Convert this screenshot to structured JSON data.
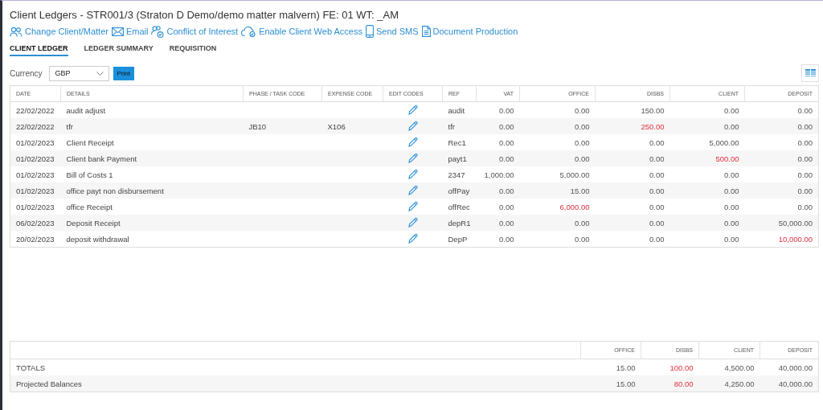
{
  "window": {
    "title": "Client Ledgers - STR001/3 (Straton D Demo/demo matter malvern) FE: 01 WT: _AM"
  },
  "actions": [
    {
      "kind": "people",
      "label": "Change Client/Matter"
    },
    {
      "kind": "mail",
      "label": "Email"
    },
    {
      "kind": "conflict",
      "label": "Conflict of Interest"
    },
    {
      "kind": "cloud",
      "label": "Enable Client Web Access"
    },
    {
      "kind": "phone",
      "label": "Send SMS"
    },
    {
      "kind": "document",
      "label": "Document Production"
    }
  ],
  "tabs": [
    {
      "label": "CLIENT LEDGER",
      "selected": true
    },
    {
      "label": "LEDGER SUMMARY",
      "selected": false
    },
    {
      "label": "REQUISITION",
      "selected": false
    }
  ],
  "currency": {
    "label": "Currency",
    "value": "GBP"
  },
  "print_button": "Print",
  "table": {
    "columns": [
      "DATE",
      "DETAILS",
      "PHASE / TASK CODE",
      "EXPENSE CODE",
      "EDIT CODES",
      "REF",
      "VAT",
      "OFFICE",
      "DISBS",
      "CLIENT",
      "DEPOSIT"
    ],
    "rows": [
      {
        "date": "22/02/2022",
        "details": "audit adjust",
        "ref": "audit",
        "amounts": [
          {
            "value": "0.00",
            "negative": false
          },
          {
            "value": "0.00",
            "negative": false
          },
          {
            "value": "150.00",
            "negative": false
          },
          {
            "value": "0.00",
            "negative": false
          },
          {
            "value": "0.00",
            "negative": false
          }
        ]
      },
      {
        "date": "22/02/2022",
        "details": "tfr",
        "phase": "JB10",
        "expense": "X106",
        "ref": "tfr",
        "amounts": [
          {
            "value": "0.00",
            "negative": false
          },
          {
            "value": "0.00",
            "negative": false
          },
          {
            "value": "250.00",
            "negative": true
          },
          {
            "value": "0.00",
            "negative": false
          },
          {
            "value": "0.00",
            "negative": false
          }
        ]
      },
      {
        "date": "01/02/2023",
        "details": "Client Receipt",
        "ref": "Rec1",
        "amounts": [
          {
            "value": "0.00",
            "negative": false
          },
          {
            "value": "0.00",
            "negative": false
          },
          {
            "value": "0.00",
            "negative": false
          },
          {
            "value": "5,000.00",
            "negative": false
          },
          {
            "value": "0.00",
            "negative": false
          }
        ]
      },
      {
        "date": "01/02/2023",
        "details": "Client bank Payment",
        "ref": "payt1",
        "amounts": [
          {
            "value": "0.00",
            "negative": false
          },
          {
            "value": "0.00",
            "negative": false
          },
          {
            "value": "0.00",
            "negative": false
          },
          {
            "value": "500.00",
            "negative": true
          },
          {
            "value": "0.00",
            "negative": false
          }
        ]
      },
      {
        "date": "01/02/2023",
        "details": "Bill of Costs 1",
        "ref": "2347",
        "amounts": [
          {
            "value": "1,000.00",
            "negative": false
          },
          {
            "value": "5,000.00",
            "negative": false
          },
          {
            "value": "0.00",
            "negative": false
          },
          {
            "value": "0.00",
            "negative": false
          },
          {
            "value": "0.00",
            "negative": false
          }
        ]
      },
      {
        "date": "01/02/2023",
        "details": "office payt non disbursement",
        "ref": "offPay",
        "amounts": [
          {
            "value": "0.00",
            "negative": false
          },
          {
            "value": "15.00",
            "negative": false
          },
          {
            "value": "0.00",
            "negative": false
          },
          {
            "value": "0.00",
            "negative": false
          },
          {
            "value": "0.00",
            "negative": false
          }
        ]
      },
      {
        "date": "01/02/2023",
        "details": "office Receipt",
        "ref": "offRec",
        "amounts": [
          {
            "value": "0.00",
            "negative": false
          },
          {
            "value": "6,000.00",
            "negative": true
          },
          {
            "value": "0.00",
            "negative": false
          },
          {
            "value": "0.00",
            "negative": false
          },
          {
            "value": "0.00",
            "negative": false
          }
        ]
      },
      {
        "date": "06/02/2023",
        "details": "Deposit Receipt",
        "ref": "depR1",
        "amounts": [
          {
            "value": "0.00",
            "negative": false
          },
          {
            "value": "0.00",
            "negative": false
          },
          {
            "value": "0.00",
            "negative": false
          },
          {
            "value": "0.00",
            "negative": false
          },
          {
            "value": "50,000.00",
            "negative": false
          }
        ]
      },
      {
        "date": "20/02/2023",
        "details": "deposit withdrawal",
        "ref": "DepP",
        "amounts": [
          {
            "value": "0.00",
            "negative": false
          },
          {
            "value": "0.00",
            "negative": false
          },
          {
            "value": "0.00",
            "negative": false
          },
          {
            "value": "0.00",
            "negative": false
          },
          {
            "value": "10,000.00",
            "negative": true
          }
        ]
      }
    ]
  },
  "totals": {
    "columns": [
      "OFFICE",
      "DISBS",
      "CLIENT",
      "DEPOSIT"
    ],
    "rows": [
      {
        "label": "TOTALS",
        "amounts": [
          {
            "value": "15.00",
            "negative": false
          },
          {
            "value": "100.00",
            "negative": true
          },
          {
            "value": "4,500.00",
            "negative": false
          },
          {
            "value": "40,000.00",
            "negative": false
          }
        ]
      },
      {
        "label": "Projected Balances",
        "amounts": [
          {
            "value": "15.00",
            "negative": false
          },
          {
            "value": "80.00",
            "negative": true
          },
          {
            "value": "4,250.00",
            "negative": false
          },
          {
            "value": "40,000.00",
            "negative": false
          }
        ]
      }
    ]
  }
}
